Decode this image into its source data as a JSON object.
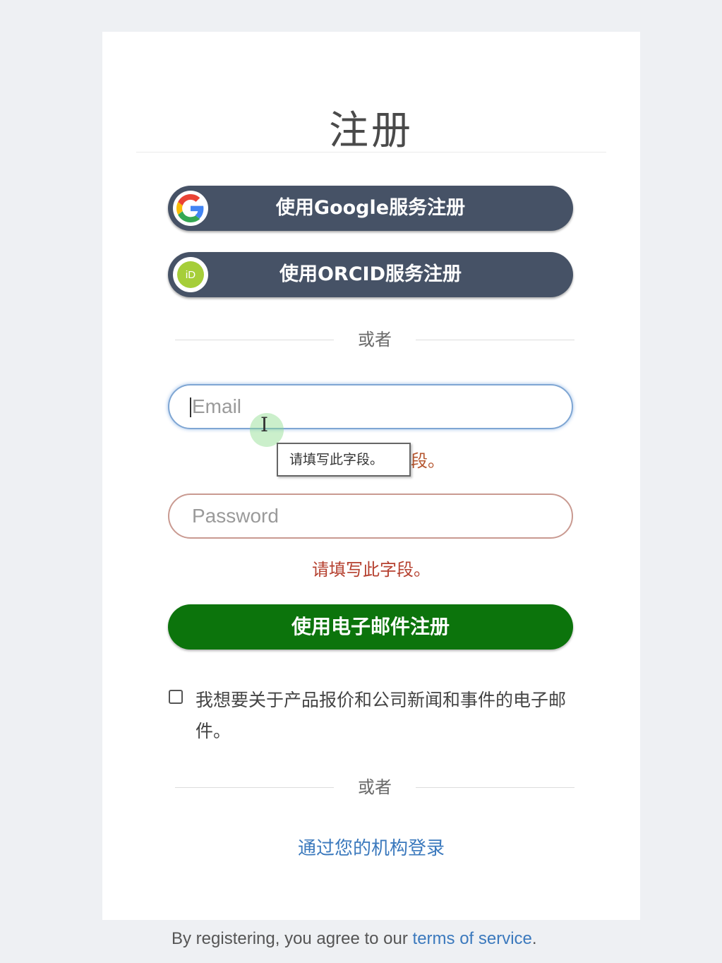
{
  "title": "注册",
  "google_button": {
    "label": "使用Google服务注册",
    "icon": "google-icon"
  },
  "orcid_button": {
    "label": "使用ORCID服务注册",
    "icon": "orcid-icon",
    "icon_text": "iD"
  },
  "divider_text": "或者",
  "email_field": {
    "placeholder": "Email",
    "value": ""
  },
  "validation_tooltip": "请填写此字段。",
  "email_error_partial": "段。",
  "password_field": {
    "placeholder": "Password",
    "value": ""
  },
  "password_error": "请填写此字段。",
  "submit_button": {
    "label": "使用电子邮件注册"
  },
  "newsletter_checkbox": {
    "label": "我想要关于产品报价和公司新闻和事件的电子邮件。",
    "checked": false
  },
  "divider_text_2": "或者",
  "institution_link": "通过您的机构登录",
  "footer": {
    "prefix": "By registering, you agree to our ",
    "link": "terms of service",
    "suffix": "."
  },
  "colors": {
    "oauth_button": "#465266",
    "submit_button": "#0c740c",
    "link": "#3b79bd",
    "error": "#b5402f"
  }
}
